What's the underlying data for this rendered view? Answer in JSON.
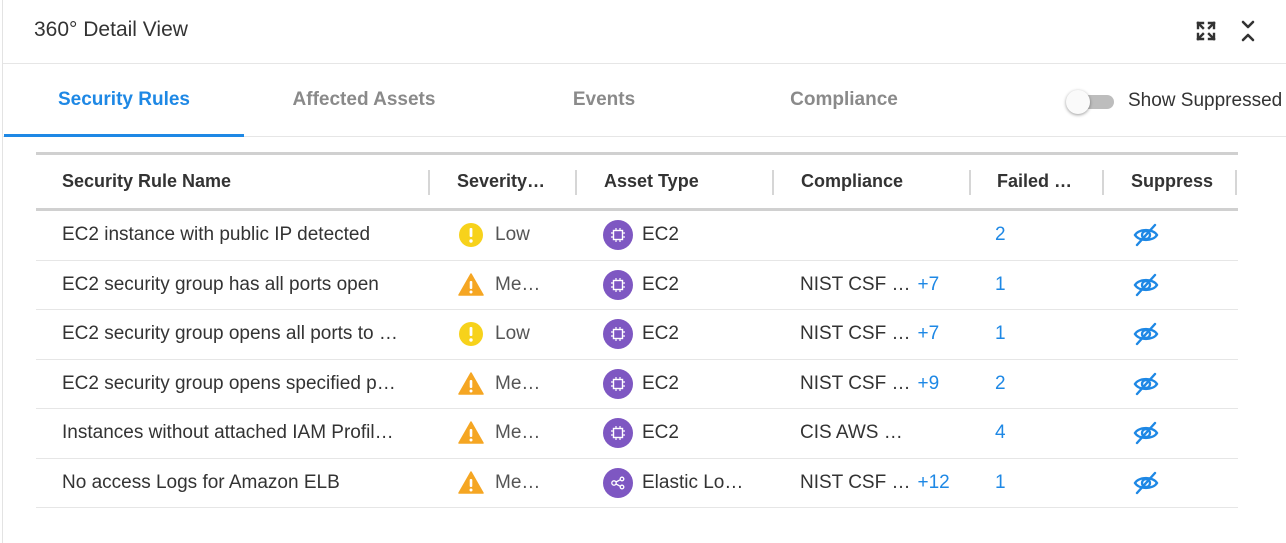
{
  "header": {
    "title": "360° Detail View"
  },
  "tabs": [
    {
      "label": "Security Rules",
      "active": true
    },
    {
      "label": "Affected Assets",
      "active": false
    },
    {
      "label": "Events",
      "active": false
    },
    {
      "label": "Compliance",
      "active": false
    }
  ],
  "toggle": {
    "label": "Show Suppressed",
    "on": false
  },
  "table": {
    "columns": [
      "Security Rule Name",
      "Severity…",
      "Asset Type",
      "Compliance",
      "Failed …",
      "Suppress"
    ],
    "rows": [
      {
        "name": "EC2 instance with public IP detected",
        "severity": "Low",
        "severity_icon": "low-icon",
        "asset": "EC2",
        "asset_icon": "chip-icon",
        "compliance": "",
        "compliance_extra": "",
        "failed": "2"
      },
      {
        "name": "EC2 security group has all ports open",
        "severity": "Me…",
        "severity_icon": "warning-icon",
        "asset": "EC2",
        "asset_icon": "chip-icon",
        "compliance": "NIST CSF …",
        "compliance_extra": "+7",
        "failed": "1"
      },
      {
        "name": "EC2 security group opens all ports to …",
        "severity": "Low",
        "severity_icon": "low-icon",
        "asset": "EC2",
        "asset_icon": "chip-icon",
        "compliance": "NIST CSF …",
        "compliance_extra": "+7",
        "failed": "1"
      },
      {
        "name": "EC2 security group opens specified p…",
        "severity": "Me…",
        "severity_icon": "warning-icon",
        "asset": "EC2",
        "asset_icon": "chip-icon",
        "compliance": "NIST CSF …",
        "compliance_extra": "+9",
        "failed": "2"
      },
      {
        "name": "Instances without attached IAM Profil…",
        "severity": "Me…",
        "severity_icon": "warning-icon",
        "asset": "EC2",
        "asset_icon": "chip-icon",
        "compliance": "CIS AWS …",
        "compliance_extra": "",
        "failed": "4"
      },
      {
        "name": "No access Logs for Amazon ELB",
        "severity": "Me…",
        "severity_icon": "warning-icon",
        "asset": "Elastic Lo…",
        "asset_icon": "load-balancer-icon",
        "compliance": "NIST CSF …",
        "compliance_extra": "+12",
        "failed": "1"
      }
    ]
  },
  "colors": {
    "accent": "#1e88e5",
    "low": "#f7d21b",
    "medium": "#f5a623",
    "asset": "#7e57c2"
  }
}
